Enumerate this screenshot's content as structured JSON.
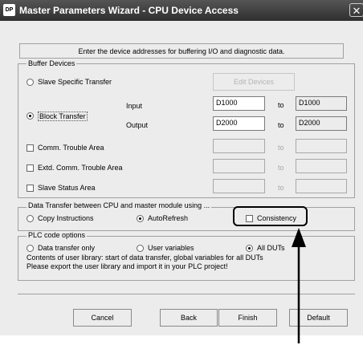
{
  "window": {
    "title": "Master Parameters Wizard - CPU Device Access",
    "icon_label": "DP",
    "close_glyph": "✕"
  },
  "intro_text": "Enter the device addresses for buffering I/O and diagnostic data.",
  "buffer_devices": {
    "group_title": "Buffer Devices",
    "slave_specific_transfer": "Slave Specific Transfer",
    "edit_devices_button": "Edit Devices",
    "block_transfer": "Block Transfer",
    "input_label": "Input",
    "output_label": "Output",
    "to_label": "to",
    "input_from": "D1000",
    "input_to": "D1000",
    "output_from": "D2000",
    "output_to": "D2000",
    "comm_trouble_area": "Comm. Trouble Area",
    "extd_comm_trouble_area": "Extd. Comm. Trouble Area",
    "slave_status_area": "Slave Status Area"
  },
  "data_transfer": {
    "group_title": "Data Transfer between CPU and master module using ...",
    "copy_instructions": "Copy Instructions",
    "auto_refresh": "AutoRefresh",
    "consistency": "Consistency"
  },
  "plc_code": {
    "group_title": "PLC code options",
    "data_transfer_only": "Data transfer only",
    "user_variables": "User variables",
    "all_duts": "All DUTs",
    "info_line1": "Contents of user library: start of data transfer, global variables for all DUTs",
    "info_line2": "Please export the user library and import it in your PLC project!"
  },
  "buttons": {
    "cancel": "Cancel",
    "back": "Back",
    "finish": "Finish",
    "default": "Default"
  }
}
